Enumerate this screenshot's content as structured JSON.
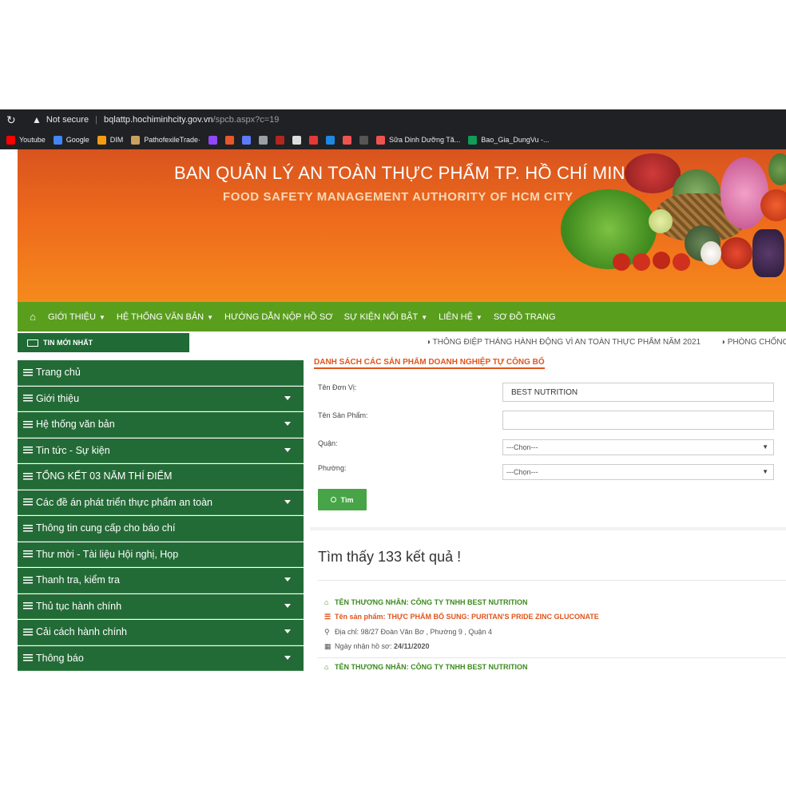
{
  "browser": {
    "security_label": "Not secure",
    "url_host": "bqlattp.hochiminhcity.gov.vn",
    "url_path": "/spcb.aspx?c=19",
    "bookmarks": [
      {
        "label": "Youtube",
        "icon": "youtube-icon",
        "color": "#ff0000"
      },
      {
        "label": "Google",
        "icon": "google-icon",
        "color": "#4285f4"
      },
      {
        "label": "DIM",
        "icon": "diamond-icon",
        "color": "#f39c12"
      },
      {
        "label": "PathofexileTrade·",
        "icon": "poe-icon",
        "color": "#c8a060"
      },
      {
        "label": "",
        "icon": "twitch-icon",
        "color": "#9146ff"
      },
      {
        "label": "",
        "icon": "g-icon",
        "color": "#e8572b"
      },
      {
        "label": "",
        "icon": "bar-icon",
        "color": "#5b7cfa"
      },
      {
        "label": "",
        "icon": "c-icon",
        "color": "#9aa0a6"
      },
      {
        "label": "",
        "icon": "e-icon",
        "color": "#b3261e"
      },
      {
        "label": "",
        "icon": "cloud-icon",
        "color": "#dddddd"
      },
      {
        "label": "",
        "icon": "red-circle-icon",
        "color": "#e53935"
      },
      {
        "label": "",
        "icon": "h-icon",
        "color": "#1e88e5"
      },
      {
        "label": "",
        "icon": "bag-icon",
        "color": "#ef5350"
      },
      {
        "label": "",
        "icon": "github-icon",
        "color": "#555555"
      },
      {
        "label": "Sữa Dinh Dưỡng Tă...",
        "icon": "shop-icon",
        "color": "#ef5350"
      },
      {
        "label": "Bao_Gia_DungVu -...",
        "icon": "sheets-icon",
        "color": "#0f9d58"
      }
    ]
  },
  "banner": {
    "title_vi": "BAN QUẢN LÝ AN TOÀN THỰC PHẨM TP. HỒ CHÍ MINH",
    "title_en": "FOOD SAFETY MANAGEMENT AUTHORITY OF HCM CITY"
  },
  "nav": {
    "items": [
      {
        "label": "GIỚI THIỆU",
        "dropdown": true
      },
      {
        "label": "HỆ THỐNG VĂN BẢN",
        "dropdown": true
      },
      {
        "label": "HƯỚNG DẪN NỘP HỒ SƠ",
        "dropdown": false
      },
      {
        "label": "SỰ KIỆN NỔI BẬT",
        "dropdown": true
      },
      {
        "label": "LIÊN HỆ",
        "dropdown": true
      },
      {
        "label": "SƠ ĐỒ TRANG",
        "dropdown": false
      }
    ]
  },
  "news": {
    "label": "TIN MỚI NHẤT",
    "ticker": [
      "◑ THÔNG ĐIỆP THÁNG HÀNH ĐỘNG VÌ AN TOÀN THỰC PHẨM NĂM 2021",
      "◑ PHÒNG CHỐNG NGỘ Đ"
    ]
  },
  "sidebar": {
    "items": [
      {
        "label": "Trang chủ",
        "dropdown": false
      },
      {
        "label": "Giới thiệu",
        "dropdown": true
      },
      {
        "label": "Hệ thống văn bản",
        "dropdown": true
      },
      {
        "label": "Tin tức - Sự kiện",
        "dropdown": true
      },
      {
        "label": "TỔNG KẾT 03 NĂM THÍ ĐIỂM",
        "dropdown": false
      },
      {
        "label": "Các đề án phát triển thực phẩm an toàn",
        "dropdown": true
      },
      {
        "label": "Thông tin cung cấp cho báo chí",
        "dropdown": false
      },
      {
        "label": "Thư mời - Tài liệu Hội nghị, Họp",
        "dropdown": false
      },
      {
        "label": "Thanh tra, kiểm tra",
        "dropdown": true
      },
      {
        "label": "Thủ tục hành chính",
        "dropdown": true
      },
      {
        "label": "Cải cách hành chính",
        "dropdown": true
      },
      {
        "label": "Thông báo",
        "dropdown": true
      }
    ]
  },
  "form": {
    "section_title": "DANH SÁCH CÁC SẢN PHẨM DOANH NGHIỆP TỰ CÔNG BỐ",
    "unit_label": "Tên Đơn Vị:",
    "unit_value": "BEST NUTRITION",
    "product_label": "Tên Sản Phẩm:",
    "product_value": "",
    "district_label": "Quận:",
    "district_value": "---Chọn---",
    "ward_label": "Phường:",
    "ward_value": "---Chọn---",
    "search_button": "Tìm"
  },
  "results": {
    "summary": "Tìm thấy 133 kết quả !",
    "items": [
      {
        "merchant": "TÊN THƯƠNG NHÂN: CÔNG TY TNHH BEST NUTRITION",
        "product_prefix": "Tên sản phẩm: ",
        "product": "THỰC PHẨM BỔ SUNG: PURITAN'S PRIDE ZINC GLUCONATE",
        "address": "Địa chỉ: 98/27 Đoàn Văn Bơ , Phường 9 , Quận 4",
        "date_label": "Ngày nhận hồ sơ: ",
        "date": "24/11/2020"
      },
      {
        "merchant": "TÊN THƯƠNG NHÂN: CÔNG TY TNHH BEST NUTRITION"
      }
    ]
  }
}
